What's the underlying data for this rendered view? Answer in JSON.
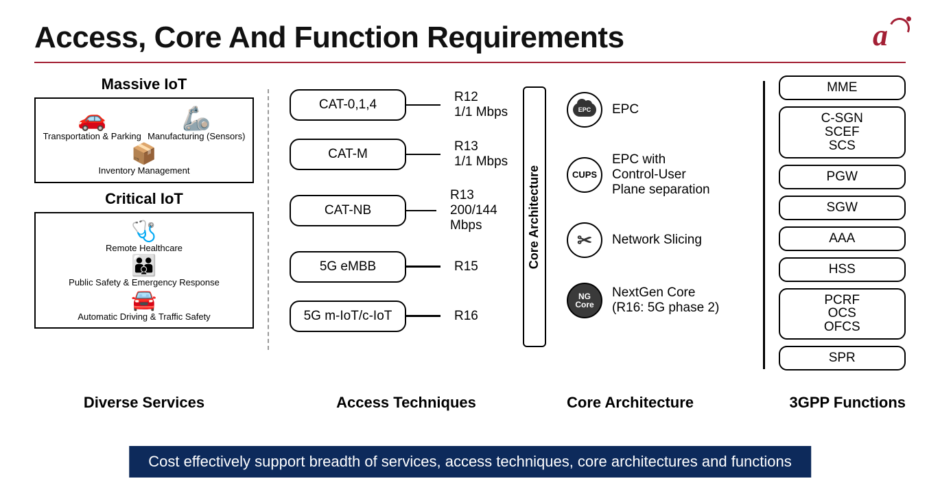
{
  "title": "Access, Core And Function Requirements",
  "logo_letter": "a",
  "diverse_services": {
    "massive_label": "Massive IoT",
    "critical_label": "Critical IoT",
    "column_label": "Diverse Services",
    "massive_items": [
      {
        "icon": "🚗",
        "label": "Transportation & Parking"
      },
      {
        "icon": "🦾",
        "label": "Manufacturing\n(Sensors)"
      },
      {
        "icon": "📦",
        "label": "Inventory\nManagement"
      }
    ],
    "critical_items": [
      {
        "icon": "🩺",
        "label": "Remote\nHealthcare"
      },
      {
        "icon": "🚘",
        "label": "Automatic Driving\n& Traffic Safety"
      },
      {
        "icon": "👪",
        "label": "Public Safety\n& Emergency\nResponse"
      }
    ]
  },
  "access": {
    "column_label": "Access Techniques",
    "items": [
      {
        "name": "CAT-0,1,4",
        "spec": "R12\n1/1 Mbps"
      },
      {
        "name": "CAT-M",
        "spec": "R13\n1/1 Mbps"
      },
      {
        "name": "CAT-NB",
        "spec": "R13\n200/144 Mbps"
      },
      {
        "name": "5G eMBB",
        "spec": "R15"
      },
      {
        "name": "5G m-IoT/c-IoT",
        "spec": "R16"
      }
    ]
  },
  "core": {
    "bar_label": "Core Architecture",
    "column_label": "Core Architecture",
    "items": [
      {
        "badge": "EPC",
        "style": "cloud",
        "label": "EPC"
      },
      {
        "badge": "CUPS",
        "style": "text",
        "label": "EPC with\nControl-User\nPlane separation"
      },
      {
        "badge": "✂",
        "style": "glyph",
        "label": "Network Slicing"
      },
      {
        "badge": "NG\nCore",
        "style": "filled",
        "label": "NextGen Core\n(R16: 5G phase 2)"
      }
    ]
  },
  "functions": {
    "column_label": "3GPP Functions",
    "items": [
      "MME",
      "C-SGN\nSCEF\nSCS",
      "PGW",
      "SGW",
      "AAA",
      "HSS",
      "PCRF\nOCS\nOFCS",
      "SPR"
    ]
  },
  "footer": "Cost effectively support breadth of services, access techniques, core architectures and functions"
}
